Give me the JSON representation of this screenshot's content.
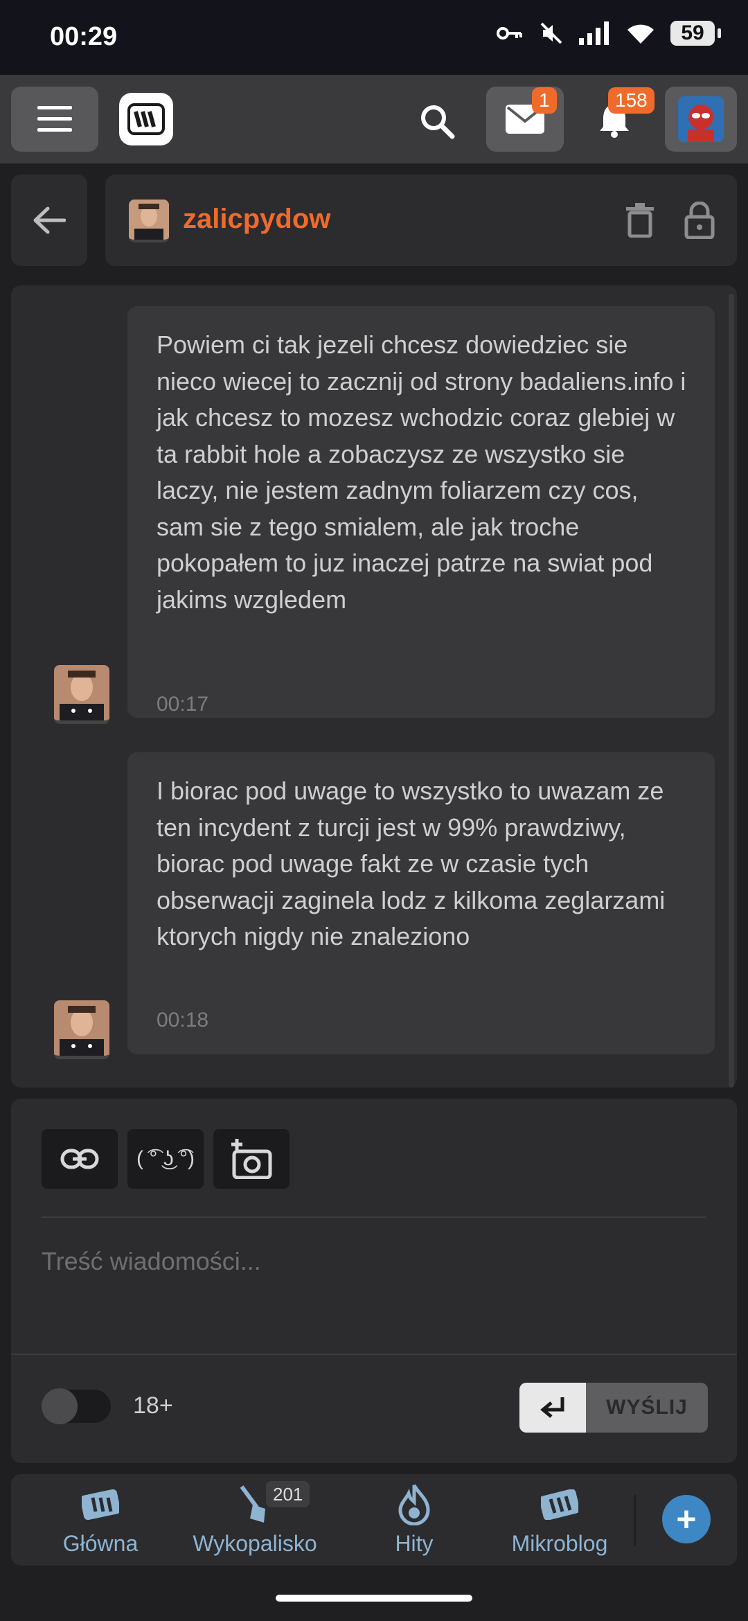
{
  "status_bar": {
    "time": "00:29",
    "battery": "59"
  },
  "top_nav": {
    "mail_badge": "1",
    "notifications_badge": "158"
  },
  "conversation": {
    "username": "zalicpydow"
  },
  "messages": [
    {
      "text": "Powiem ci tak jezeli chcesz dowiedziec sie nieco wiecej to zacznij od strony badaliens.info i jak chcesz to mozesz wchodzic coraz glebiej w ta rabbit hole a zobaczysz ze wszystko sie laczy, nie jestem zadnym foliarzem czy cos, sam sie z tego smialem, ale jak troche pokopałem to juz inaczej patrze na swiat pod jakims wzgledem",
      "time": "00:17"
    },
    {
      "text": "I biorac pod uwage to wszystko to uwazam ze ten incydent z turcji jest w 99% prawdziwy, biorac pod uwage fakt ze w czasie tych obserwacji zaginela lodz z kilkoma zeglarzami ktorych nigdy nie znaleziono",
      "time": "00:18"
    }
  ],
  "composer": {
    "lenny_label": "( ͡° ͜ʖ ͡°)",
    "placeholder": "Treść wiadomości...",
    "adult_label": "18+",
    "adult_toggle": false,
    "send_label": "WYŚLIJ"
  },
  "bottom_nav": {
    "items": [
      {
        "label": "Główna",
        "icon": "wykop-logo-icon"
      },
      {
        "label": "Wykopalisko",
        "icon": "shovel-icon",
        "badge": "201"
      },
      {
        "label": "Hity",
        "icon": "flame-icon"
      },
      {
        "label": "Mikroblog",
        "icon": "mikroblog-icon"
      }
    ],
    "add_label": "+"
  },
  "colors": {
    "accent": "#f06b2b",
    "nav_blue": "#8fb4d2",
    "fab_blue": "#3d87c4"
  }
}
